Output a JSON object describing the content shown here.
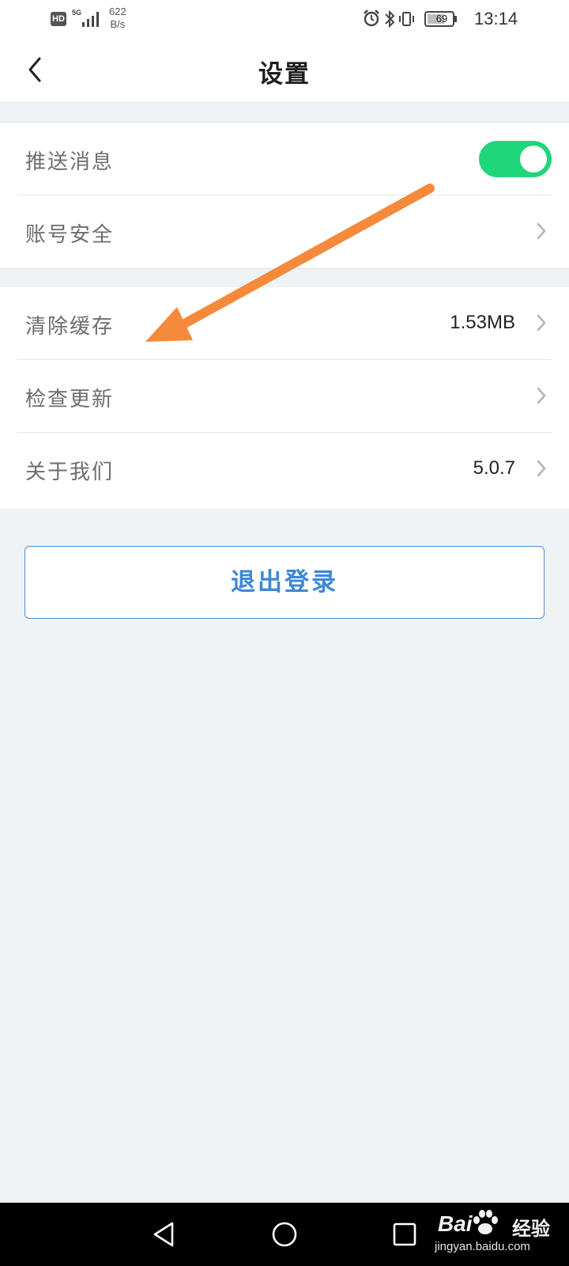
{
  "status_bar": {
    "hd": "HD",
    "network": "5G",
    "speed_value": "622",
    "speed_unit": "B/s",
    "battery": "69",
    "time": "13:14"
  },
  "header": {
    "title": "设置"
  },
  "settings_group_1": [
    {
      "label": "推送消息",
      "toggle_on": true
    },
    {
      "label": "账号安全"
    }
  ],
  "settings_group_2": [
    {
      "label": "清除缓存",
      "value": "1.53MB"
    },
    {
      "label": "检查更新"
    },
    {
      "label": "关于我们",
      "value": "5.0.7"
    }
  ],
  "logout": {
    "label": "退出登录"
  },
  "watermark": {
    "logo": "Bai",
    "logo_suffix": "经验",
    "url": "jingyan.baidu.com"
  },
  "colors": {
    "toggle_on": "#1fd67a",
    "logout_text": "#3c88d6",
    "annotation_arrow": "#f58a3c",
    "background": "#eff3f5"
  }
}
